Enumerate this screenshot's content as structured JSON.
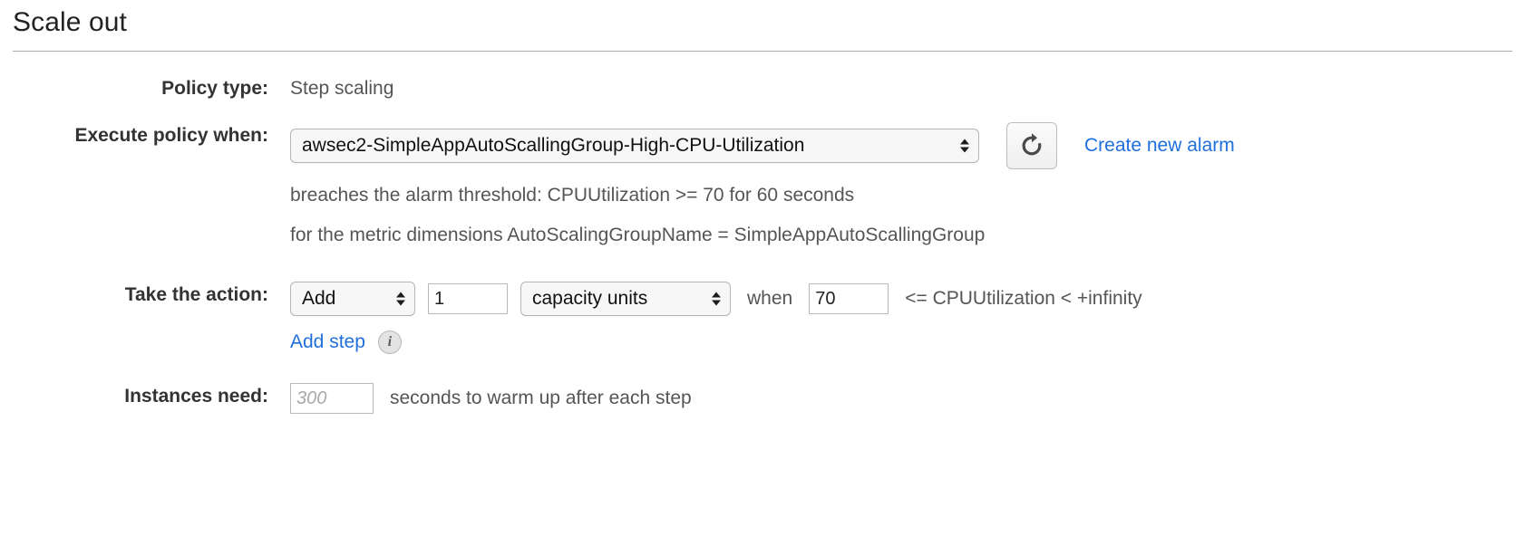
{
  "panel": {
    "title": "Scale out"
  },
  "policy_type": {
    "label": "Policy type:",
    "value": "Step scaling"
  },
  "execute_policy": {
    "label": "Execute policy when:",
    "alarm_selected": "awsec2-SimpleAppAutoScallingGroup-High-CPU-Utilization",
    "refresh_icon": "refresh-icon",
    "create_alarm_link": "Create new alarm",
    "threshold_description": "breaches the alarm threshold: CPUUtilization >= 70 for 60 seconds",
    "dimensions_description": "for the metric dimensions AutoScalingGroupName = SimpleAppAutoScallingGroup"
  },
  "take_action": {
    "label": "Take the action:",
    "action_selected": "Add",
    "quantity_value": "1",
    "unit_selected": "capacity units",
    "when_text": "when",
    "threshold_value": "70",
    "bound_text": "<= CPUUtilization < +infinity",
    "add_step_link": "Add step",
    "info_icon": "info-icon"
  },
  "instances_need": {
    "label": "Instances need:",
    "warmup_value": "",
    "warmup_placeholder": "300",
    "suffix_text": "seconds to warm up after each step"
  }
}
